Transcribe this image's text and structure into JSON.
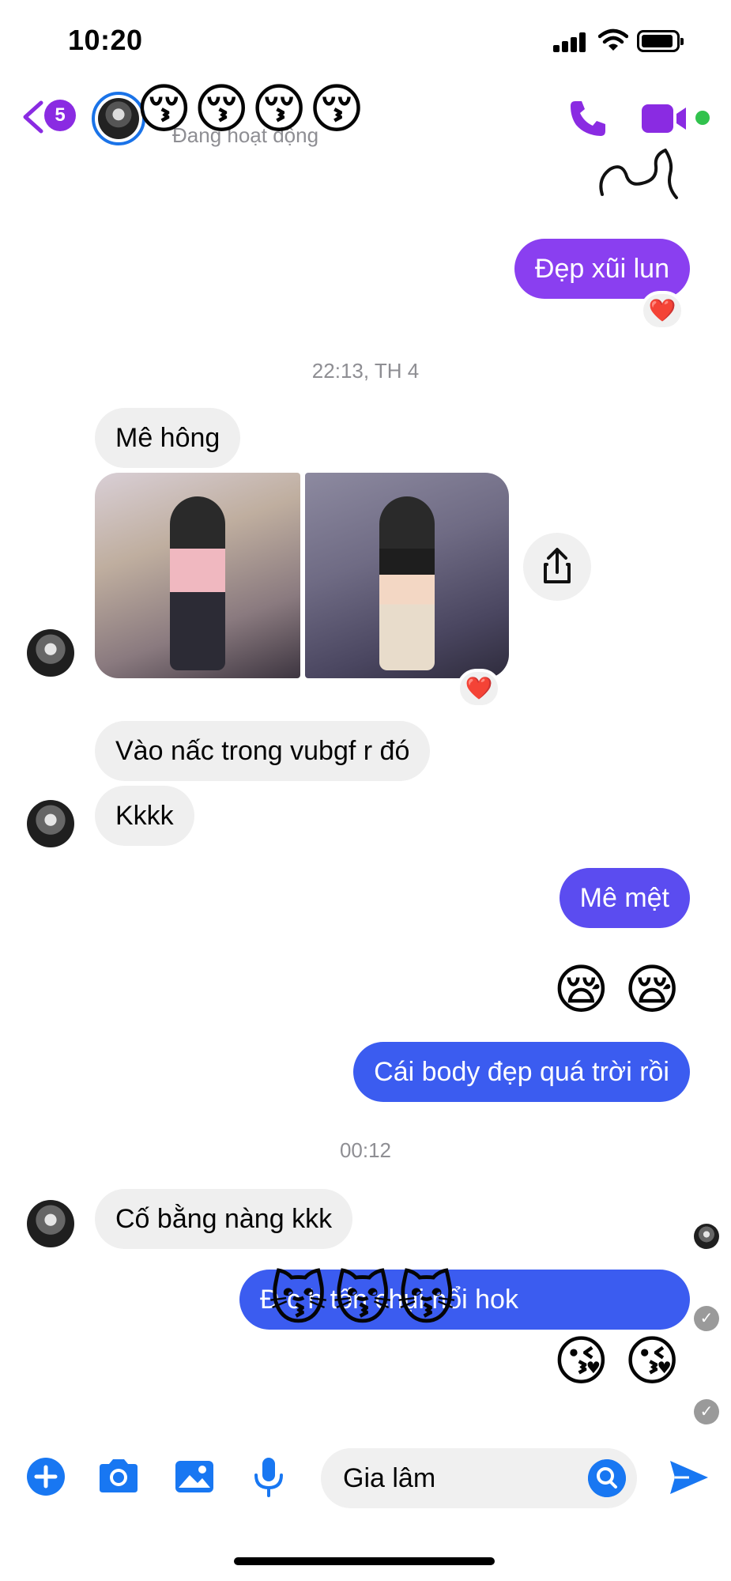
{
  "status_bar": {
    "time": "10:20"
  },
  "header": {
    "back_count": "5",
    "contact_status": "Đang hoạt động",
    "redaction_emojis": [
      "😚",
      "😚",
      "😚",
      "😚"
    ]
  },
  "messages": {
    "m1": {
      "text": "Đẹp xũi lun",
      "reaction": "❤️"
    },
    "ts1": "22:13, TH 4",
    "m2": {
      "text": "Mê hông"
    },
    "photos_reaction": "❤️",
    "m3": {
      "text": "Vào nấc trong vubgf r đó"
    },
    "m4": {
      "text": "Kkkk"
    },
    "m5": {
      "text": "Mê mệt"
    },
    "e1": "😪 😪",
    "m6": {
      "text": "Cái body đẹp quá trời rồi"
    },
    "ts2": "00:12",
    "m7": {
      "text": "Cố bằng nàng kkk"
    },
    "m8": {
      "text": "Đ   c     h     tốn chụi nổi hok"
    },
    "cat_overlay": [
      "😽",
      "😽",
      "😽"
    ],
    "e2": "😘 😘"
  },
  "composer": {
    "input_value": "Gia lâm"
  },
  "colors": {
    "accent": "#8a2be2",
    "out_blue": "#3b5cf0",
    "out_purple": "#8a3ff0",
    "incoming": "#efefef"
  }
}
